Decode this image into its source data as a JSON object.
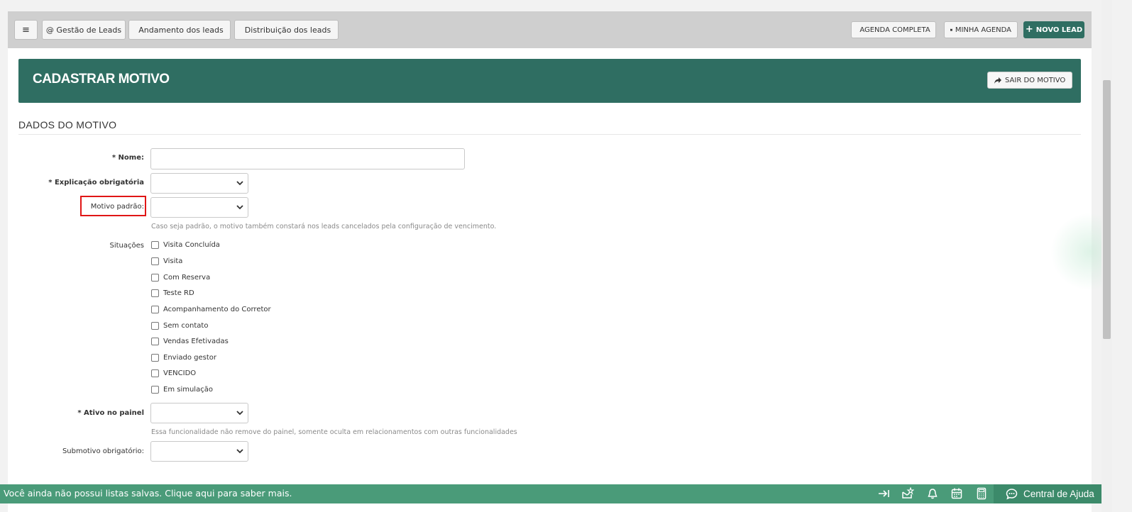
{
  "topbar": {
    "menu_icon": "≡",
    "leads_mgmt": "@ Gestão de Leads",
    "leads_progress": "Andamento dos leads",
    "leads_distribution": "Distribuição dos leads",
    "full_agenda": "AGENDA COMPLETA",
    "my_agenda": "MINHA AGENDA",
    "new_lead": "NOVO LEAD"
  },
  "banner": {
    "title": "CADASTRAR MOTIVO",
    "exit_label": "SAIR DO MOTIVO"
  },
  "section": {
    "title": "DADOS DO MOTIVO"
  },
  "form": {
    "name_label": "* Nome:",
    "name_value": "",
    "explanation_label": "* Explicação obrigatória",
    "explanation_value": "",
    "default_label": "Motivo padrão:",
    "default_value": "",
    "default_help": "Caso seja padrão, o motivo também constará nos leads cancelados pela configuração de vencimento.",
    "situations_label": "Situações",
    "situations": [
      "Visita Concluída",
      "Visita",
      "Com Reserva",
      "Teste RD",
      "Acompanhamento do Corretor",
      "Sem contato",
      "Vendas Efetivadas",
      "Enviado gestor",
      "VENCIDO",
      "Em simulação"
    ],
    "active_label": "* Ativo no painel",
    "active_value": "",
    "active_help": "Essa funcionalidade não remove do painel, somente oculta em relacionamentos com outras funcionalidades",
    "submotive_label": "Submotivo obrigatório:",
    "submotive_value": ""
  },
  "bottom": {
    "message": "Você ainda não possui listas salvas. Clique aqui para saber mais.",
    "help_center": "Central de Ajuda"
  },
  "colors": {
    "primary": "#2f6e62",
    "bottom_bar": "#4a9b79",
    "highlight": "#e01616"
  }
}
